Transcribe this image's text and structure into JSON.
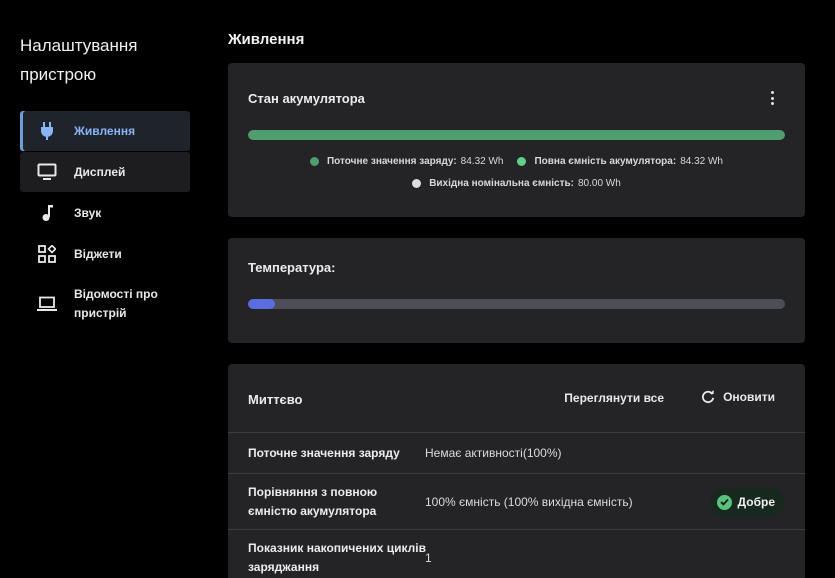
{
  "sidebar": {
    "title": "Налаштування пристрою",
    "items": [
      {
        "label": "Живлення",
        "icon": "power-plug-icon",
        "active": true
      },
      {
        "label": "Дисплей",
        "icon": "monitor-icon"
      },
      {
        "label": "Звук",
        "icon": "music-note-icon"
      },
      {
        "label": "Віджети",
        "icon": "widgets-icon"
      },
      {
        "label": "Відомості про пристрій",
        "icon": "laptop-icon"
      }
    ]
  },
  "main": {
    "title": "Живлення"
  },
  "battery": {
    "title": "Стан акумулятора",
    "menu_icon": "more-vert-icon",
    "level_fraction": 1.0,
    "bar_color": "#4f9e6f",
    "legend": [
      {
        "label": "Поточне значення заряду:",
        "value": "84.32 Wh",
        "color": "#4f9e6f"
      },
      {
        "label": "Повна ємність акумулятора:",
        "value": "84.32 Wh",
        "color": "#5fd08a"
      },
      {
        "label": "Вихідна номінальна ємність:",
        "value": "80.00 Wh",
        "color": "#dcdde2"
      }
    ]
  },
  "temperature": {
    "title": "Температура:",
    "level_fraction": 0.05,
    "fill_color": "#5b6ee1",
    "track_color": "#4d4e58"
  },
  "instant": {
    "title": "Миттєво",
    "view_all_label": "Переглянути все",
    "refresh_label": "Оновити",
    "refresh_icon": "refresh-icon",
    "rows": [
      {
        "key": "Поточне значення заряду",
        "value": "Немає активності(100%)"
      },
      {
        "key": "Порівняння з повною ємністю акумулятора",
        "value": "100% ємність (100% вихідна ємність)",
        "badge": "Добре"
      },
      {
        "key": "Показник накопичених циклів заряджання",
        "value": "1"
      }
    ]
  }
}
